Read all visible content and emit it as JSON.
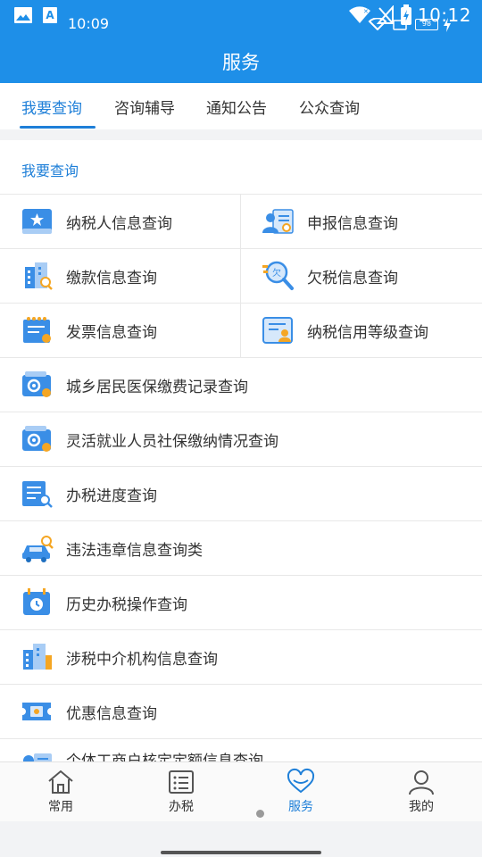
{
  "status_bar": {
    "left_time": "10:09",
    "clock": "10:12",
    "battery_level": "98"
  },
  "header": {
    "title": "服务"
  },
  "tabs": [
    {
      "label": "我要查询",
      "active": true
    },
    {
      "label": "咨询辅导",
      "active": false
    },
    {
      "label": "通知公告",
      "active": false
    },
    {
      "label": "公众查询",
      "active": false
    }
  ],
  "section": {
    "title": "我要查询"
  },
  "grid": [
    {
      "left": {
        "label": "纳税人信息查询",
        "icon": "taxpayer-card-icon"
      },
      "right": {
        "label": "申报信息查询",
        "icon": "declaration-person-icon"
      }
    },
    {
      "left": {
        "label": "缴款信息查询",
        "icon": "payment-building-icon"
      },
      "right": {
        "label": "欠税信息查询",
        "icon": "arrears-search-icon"
      }
    },
    {
      "left": {
        "label": "发票信息查询",
        "icon": "invoice-icon"
      },
      "right": {
        "label": "纳税信用等级查询",
        "icon": "credit-rating-icon"
      }
    }
  ],
  "list": [
    {
      "label": "城乡居民医保缴费记录查询",
      "icon": "medical-insurance-card-icon"
    },
    {
      "label": "灵活就业人员社保缴纳情况查询",
      "icon": "social-security-card-icon"
    },
    {
      "label": "办税进度查询",
      "icon": "progress-doc-icon"
    },
    {
      "label": "违法违章信息查询类",
      "icon": "car-violation-icon"
    },
    {
      "label": "历史办税操作查询",
      "icon": "history-calendar-icon"
    },
    {
      "label": "涉税中介机构信息查询",
      "icon": "agency-building-icon"
    },
    {
      "label": "优惠信息查询",
      "icon": "discount-ticket-icon"
    },
    {
      "label": "个体工商户核定定额信息查询",
      "icon": "business-doc-icon"
    }
  ],
  "bottom_nav": [
    {
      "label": "常用",
      "icon": "home-icon",
      "active": false
    },
    {
      "label": "办税",
      "icon": "list-icon",
      "active": false
    },
    {
      "label": "服务",
      "icon": "heart-icon",
      "active": true
    },
    {
      "label": "我的",
      "icon": "person-icon",
      "active": false
    }
  ],
  "colors": {
    "primary": "#1e8fe8",
    "accent_text": "#1e7fd8",
    "icon_blue": "#3a8ee6",
    "icon_orange": "#f5a623"
  }
}
